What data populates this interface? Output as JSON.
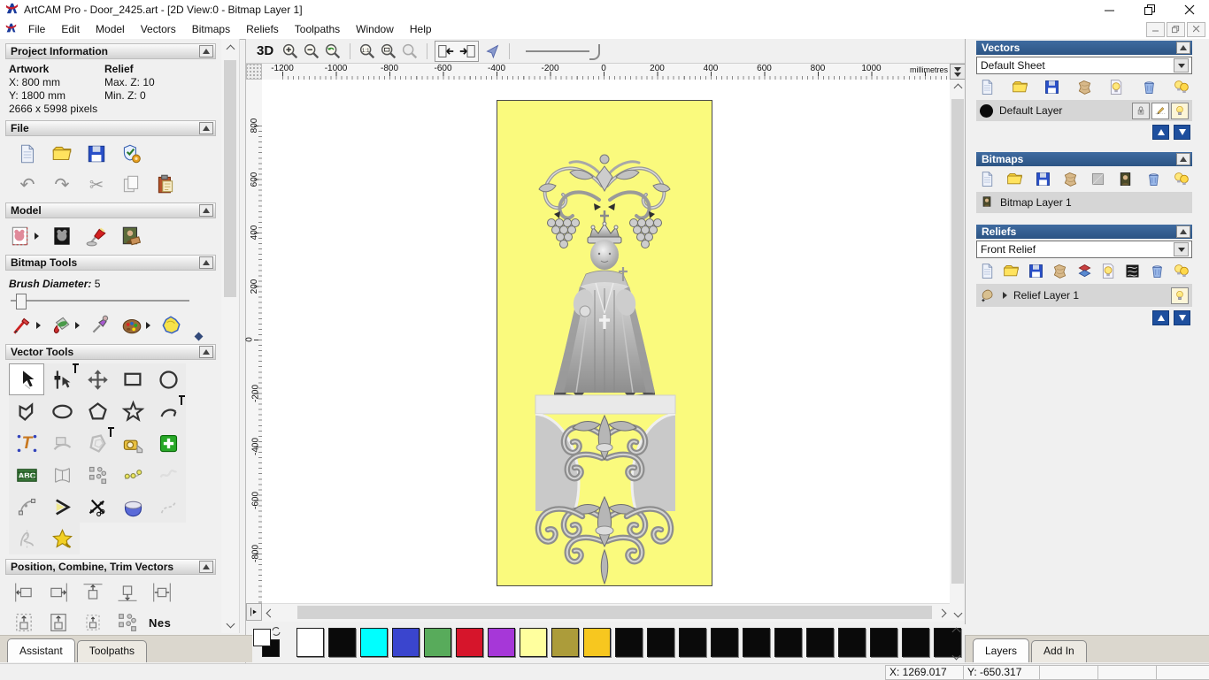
{
  "titlebar": {
    "title": "ArtCAM Pro - Door_2425.art - [2D View:0 - Bitmap Layer 1]"
  },
  "menubar": {
    "items": [
      "File",
      "Edit",
      "Model",
      "Vectors",
      "Bitmaps",
      "Reliefs",
      "Toolpaths",
      "Window",
      "Help"
    ]
  },
  "assistant": {
    "project": {
      "title": "Project Information",
      "artwork_label": "Artwork",
      "relief_label": "Relief",
      "x": "X: 800 mm",
      "y": "Y: 1800 mm",
      "pixels": "2666 x 5998 pixels",
      "max_z": "Max. Z: 10",
      "min_z": "Min. Z: 0"
    },
    "file": {
      "title": "File",
      "row1": [
        "page",
        "folder",
        "floppy",
        "wizard"
      ],
      "row2": [
        "undo",
        "redo",
        "cut",
        "copy",
        "paste"
      ]
    },
    "model": {
      "title": "Model",
      "icons": [
        "set-model-size*",
        "invert-model",
        "lighting",
        "load-image"
      ]
    },
    "bitmap_tools": {
      "title": "Bitmap Tools",
      "brush_label": "Brush Diameter:",
      "brush_value": "5",
      "icons": [
        "paint-brush*",
        "paint-bucket*",
        "colour-picker",
        "palette*",
        "flood-fill"
      ]
    },
    "vector_tools": {
      "title": "Vector Tools",
      "grid": [
        "select-vectors",
        "node-editing",
        "transform-vectors",
        "create-rectangle",
        "create-circle",
        "create-polyline",
        "create-ellipse",
        "create-polygon",
        "create-star",
        "create-arc",
        "create-text",
        "wrap-text",
        "offset-vector",
        "measure-tool",
        "paste-center",
        "text-panel",
        "envelope-distort",
        "block-copy",
        "paste-along-curve",
        "fade-vectors",
        "fit-arcs",
        "join-vectors",
        "trim-vectors",
        "spin-relief",
        "dashed-profile",
        "slice-vectors",
        "vector-doctor"
      ]
    },
    "position": {
      "title": "Position, Combine, Trim Vectors",
      "row1": [
        "align-left",
        "align-right",
        "align-top",
        "align-bottom",
        "center-page"
      ],
      "row2": [
        "align-b1",
        "align-b2",
        "align-b3",
        "block-copy"
      ],
      "nes_label": "Nes"
    },
    "tabs": [
      "Assistant",
      "Toolpaths"
    ],
    "active_tab": "Assistant"
  },
  "view_toolbar": {
    "label_3d": "3D",
    "zoom_icons": [
      "zoom-in",
      "zoom-out",
      "zoom-prev"
    ],
    "zoom_icons2": [
      "zoom-11",
      "zoom-box",
      "zoom-obj"
    ],
    "cursor_icon": [
      "blue-cursor"
    ],
    "snap_icons": [
      "snap-in",
      "snap-out"
    ]
  },
  "rulers": {
    "horizontal": [
      "-1200",
      "-1000",
      "-800",
      "-600",
      "-400",
      "-200",
      "0",
      "200",
      "400",
      "600",
      "800",
      "1000"
    ],
    "vertical": [
      "800",
      "600",
      "400",
      "200",
      "0",
      "-200",
      "-400",
      "-600",
      "-800"
    ],
    "units": "millimetres"
  },
  "vectors_panel": {
    "title": "Vectors",
    "sheet": "Default Sheet",
    "toolbar": [
      "page",
      "folder",
      "floppy",
      "merge",
      "bulb-page",
      "trash",
      "bulbs"
    ],
    "layer": "Default Layer"
  },
  "bitmaps_panel": {
    "title": "Bitmaps",
    "toolbar": [
      "page",
      "folder",
      "floppy",
      "merge",
      "grey-square",
      "mona",
      "trash",
      "bulbs"
    ],
    "layer": "Bitmap Layer 1"
  },
  "reliefs_panel": {
    "title": "Reliefs",
    "relief": "Front Relief",
    "toolbar": [
      "page",
      "folder",
      "floppy",
      "merge",
      "stack",
      "bulb-page",
      "zebra",
      "trash",
      "bulbs"
    ],
    "layer": "Relief Layer 1"
  },
  "right_tabs": {
    "tabs": [
      "Layers",
      "Add In"
    ],
    "active_tab": "Layers"
  },
  "palette": {
    "colors": [
      "#ffffff",
      "#0a0a0a",
      "#00ffff",
      "#3a45ce",
      "#58ab5b",
      "#d6152b",
      "#a637d8",
      "#ffff9e",
      "#ac9c3a",
      "#f7c71f",
      "#0a0a0a",
      "#0a0a0a",
      "#0a0a0a",
      "#0a0a0a",
      "#0a0a0a",
      "#0a0a0a",
      "#0a0a0a",
      "#0a0a0a",
      "#0a0a0a",
      "#0a0a0a",
      "#0a0a0a"
    ]
  },
  "statusbar": {
    "x": "X: 1269.017",
    "y": "Y: -650.317"
  },
  "artwork": {
    "background": "#fafa7d"
  }
}
